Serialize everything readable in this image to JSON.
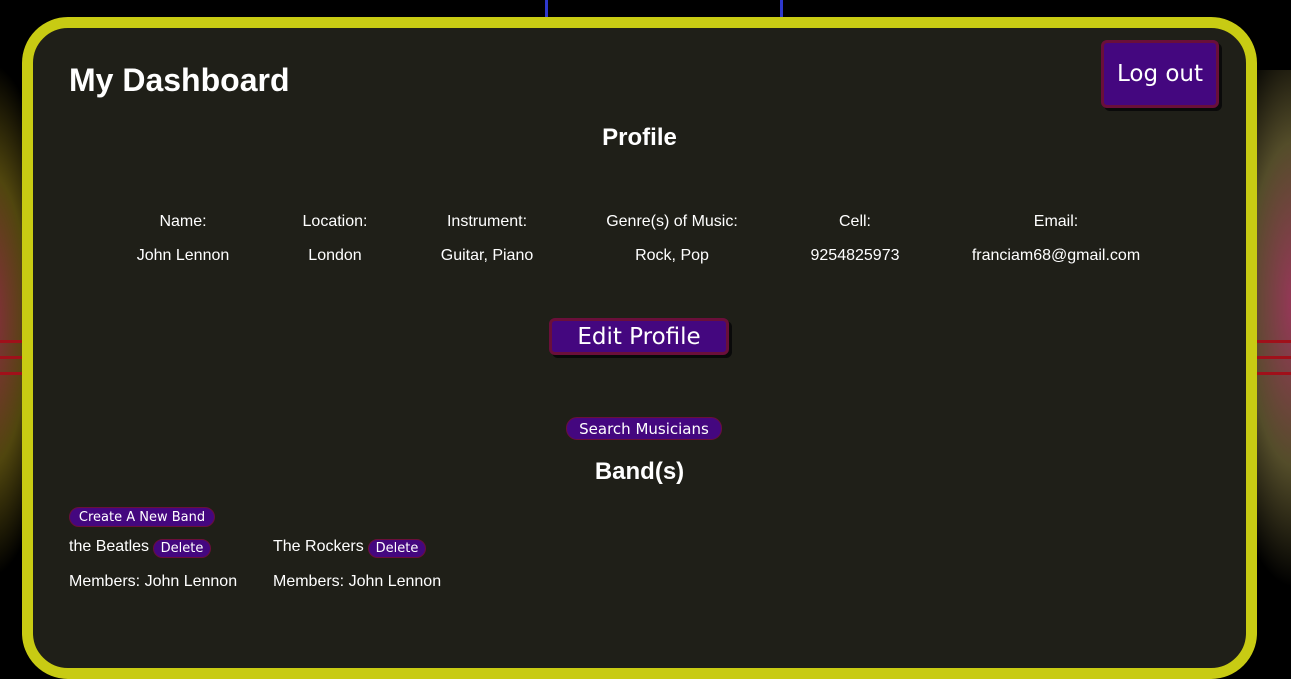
{
  "header": {
    "title": "My Dashboard",
    "logout_label": "Log out"
  },
  "profile": {
    "heading": "Profile",
    "fields": [
      {
        "label": "Name:",
        "value": "John Lennon"
      },
      {
        "label": "Location:",
        "value": "London"
      },
      {
        "label": "Instrument:",
        "value": "Guitar, Piano"
      },
      {
        "label": "Genre(s) of Music:",
        "value": "Rock, Pop"
      },
      {
        "label": "Cell:",
        "value": "9254825973"
      },
      {
        "label": "Email:",
        "value": "franciam68@gmail.com"
      }
    ],
    "edit_label": "Edit Profile"
  },
  "search_label": "Search Musicians",
  "bands": {
    "heading": "Band(s)",
    "create_label": "Create A New Band",
    "items": [
      {
        "name": "the Beatles",
        "delete_label": "Delete",
        "members": "Members: John Lennon"
      },
      {
        "name": "The Rockers",
        "delete_label": "Delete",
        "members": "Members: John Lennon"
      }
    ]
  },
  "colors": {
    "panel_bg": "#1f1f18",
    "panel_border": "#c8cb13",
    "button_bg": "#44077f",
    "button_border": "#6a0f3a"
  }
}
